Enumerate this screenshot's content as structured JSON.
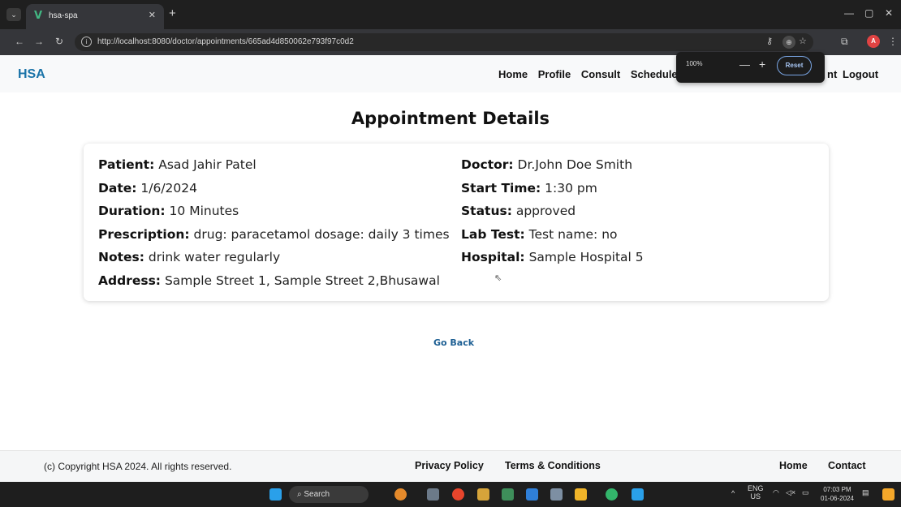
{
  "browser": {
    "tab_title": "hsa-spa",
    "url": "http://localhost:8080/doctor/appointments/665ad4d850062e793f97c0d2",
    "zoom_popup": {
      "level": "100%",
      "reset_label": "Reset"
    }
  },
  "app": {
    "brand": "HSA",
    "nav": {
      "home": "Home",
      "profile": "Profile",
      "consult": "Consult",
      "schedule": "Schedule",
      "tail": "nt",
      "logout": "Logout"
    }
  },
  "page": {
    "title": "Appointment Details",
    "left_fields": [
      {
        "label": "Patient:",
        "value": "Asad Jahir Patel"
      },
      {
        "label": "Date:",
        "value": "1/6/2024"
      },
      {
        "label": "Duration:",
        "value": "10 Minutes"
      },
      {
        "label": "Prescription:",
        "value": "drug: paracetamol dosage: daily 3 times"
      },
      {
        "label": "Notes:",
        "value": "drink water regularly"
      },
      {
        "label": "Address:",
        "value": "Sample Street 1, Sample Street 2,Bhusawal"
      }
    ],
    "right_fields": [
      {
        "label": "Doctor:",
        "value": "Dr.John Doe Smith"
      },
      {
        "label": "Start Time:",
        "value": "1:30 pm"
      },
      {
        "label": "Status:",
        "value": "approved"
      },
      {
        "label": "Lab Test:",
        "value": "Test name: no"
      },
      {
        "label": "Hospital:",
        "value": "Sample Hospital 5"
      }
    ],
    "go_back": "Go Back"
  },
  "footer": {
    "copyright": "(c) Copyright HSA 2024. All rights reserved.",
    "privacy": "Privacy Policy",
    "terms": "Terms & Conditions",
    "home": "Home",
    "contact": "Contact"
  },
  "taskbar": {
    "search_placeholder": "Search",
    "lang_top": "ENG",
    "lang_bottom": "US",
    "time": "07:03 PM",
    "date": "01-06-2024"
  }
}
